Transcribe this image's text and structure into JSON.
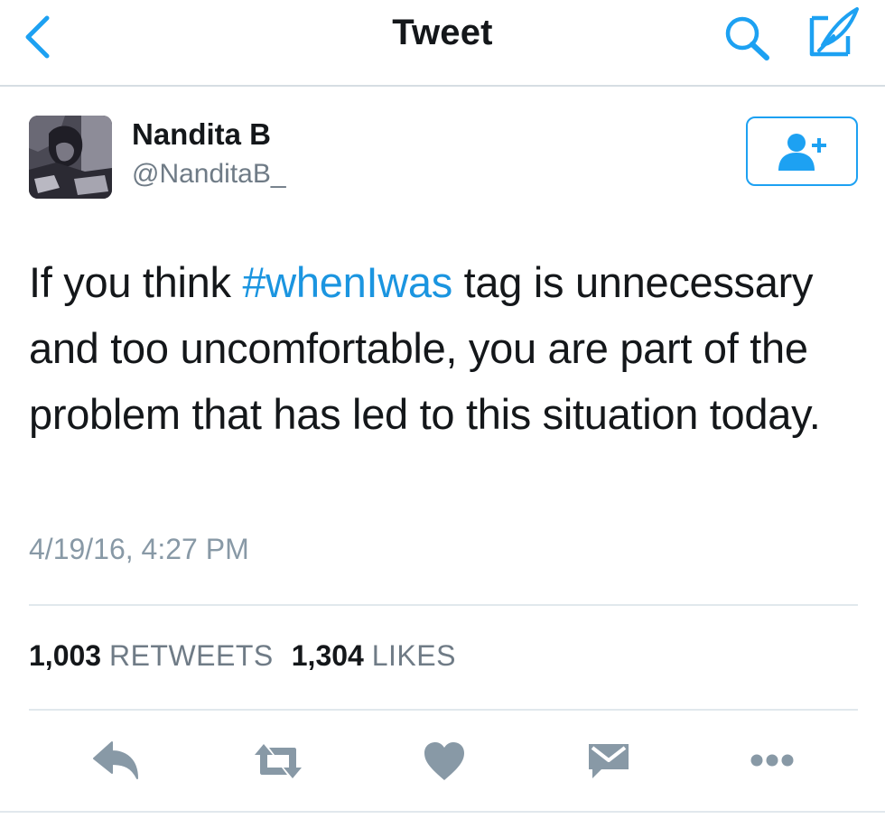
{
  "nav": {
    "title": "Tweet",
    "icons": [
      "back-chevron-icon",
      "search-icon",
      "compose-icon"
    ]
  },
  "colors": {
    "accent": "#1da1f2",
    "hashtag": "#1b95e0",
    "text": "#14171a",
    "secondary": "#8899a6",
    "action_icons": "#8899a6"
  },
  "author": {
    "name": "Nandita B",
    "handle": "@NanditaB_",
    "follow_icon": "add-user-icon"
  },
  "tweet": {
    "text_before": "If you think ",
    "hashtag": "#whenIwas",
    "text_after": " tag is unnecessary and too uncomfortable, you are part of the problem that has led to this situation today.",
    "timestamp": "4/19/16, 4:27 PM"
  },
  "stats": {
    "retweets_count": "1,003",
    "retweets_label": "RETWEETS",
    "likes_count": "1,304",
    "likes_label": "LIKES"
  },
  "actions": [
    "reply-icon",
    "retweet-icon",
    "like-icon",
    "direct-message-icon",
    "more-icon"
  ]
}
